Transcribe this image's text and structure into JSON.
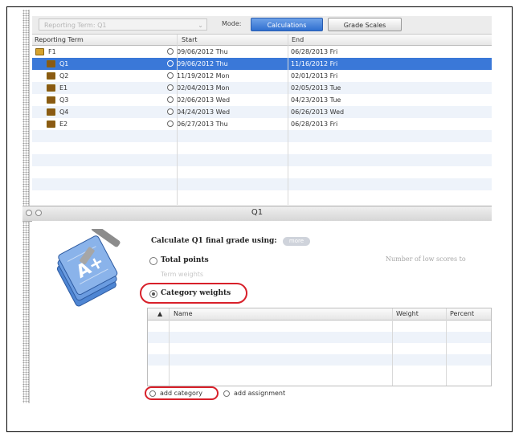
{
  "toolbar": {
    "reporting_term_placeholder": "Reporting Term: Q1",
    "mode_label": "Mode:",
    "calculations_label": "Calculations",
    "grade_scales_label": "Grade Scales"
  },
  "term_table": {
    "columns": [
      "Reporting Term",
      "Start",
      "End"
    ],
    "rows": [
      {
        "term": "F1",
        "start": "09/06/2012 Thu",
        "end": "06/28/2013 Fri",
        "level": 0,
        "selected": false
      },
      {
        "term": "Q1",
        "start": "09/06/2012 Thu",
        "end": "11/16/2012 Fri",
        "level": 1,
        "selected": true
      },
      {
        "term": "Q2",
        "start": "11/19/2012 Mon",
        "end": "02/01/2013 Fri",
        "level": 1,
        "selected": false
      },
      {
        "term": "E1",
        "start": "02/04/2013 Mon",
        "end": "02/05/2013 Tue",
        "level": 1,
        "selected": false
      },
      {
        "term": "Q3",
        "start": "02/06/2013 Wed",
        "end": "04/23/2013 Tue",
        "level": 1,
        "selected": false
      },
      {
        "term": "Q4",
        "start": "04/24/2013 Wed",
        "end": "06/26/2013 Wed",
        "level": 1,
        "selected": false
      },
      {
        "term": "E2",
        "start": "06/27/2013 Thu",
        "end": "06/28/2013 Fri",
        "level": 1,
        "selected": false
      }
    ]
  },
  "panel": {
    "title": "Q1",
    "calc_label": "Calculate Q1 final grade using:",
    "info_pill": "more",
    "options": {
      "total_points": "Total points",
      "term_weights": "Term weights",
      "category_weights": "Category weights"
    },
    "low_scores_label": "Number of low scores to",
    "category_table": {
      "columns": [
        "▲",
        "Name",
        "Weight",
        "Percent"
      ]
    },
    "add_category_label": "add category",
    "add_assignment_label": "add assignment"
  },
  "colors": {
    "selection_blue": "#3a78d8",
    "highlight_red": "#d8202a",
    "folder_gold": "#d6a22d"
  }
}
